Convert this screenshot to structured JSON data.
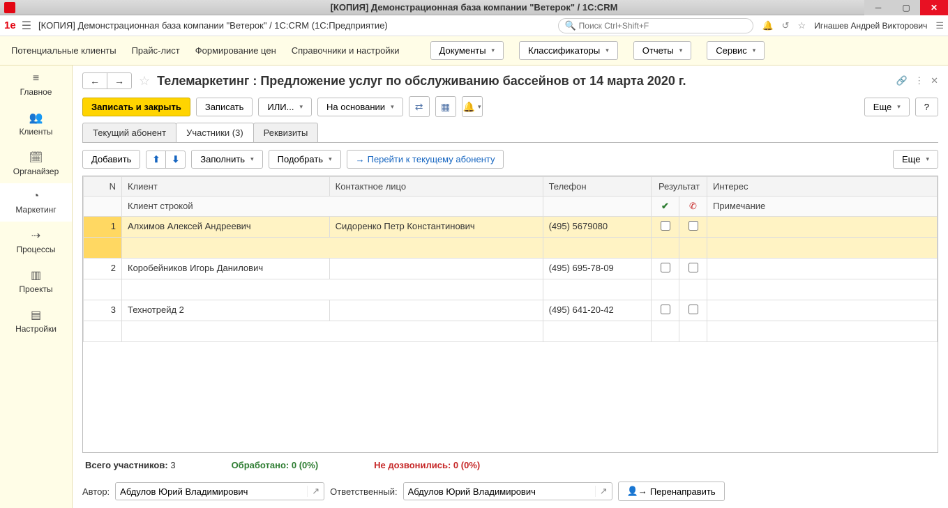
{
  "window": {
    "title": "[КОПИЯ] Демонстрационная база компании \"Ветерок\" / 1C:CRM"
  },
  "app": {
    "breadcrumb": "[КОПИЯ] Демонстрационная база компании \"Ветерок\" / 1C:CRM  (1С:Предприятие)",
    "search_placeholder": "Поиск Ctrl+Shift+F",
    "user": "Игнашев Андрей Викторович"
  },
  "menu": {
    "items": [
      "Потенциальные клиенты",
      "Прайс-лист",
      "Формирование цен",
      "Справочники и настройки"
    ],
    "buttons": [
      "Документы",
      "Классификаторы",
      "Отчеты",
      "Сервис"
    ]
  },
  "sidebar": [
    {
      "label": "Главное",
      "icon": "≡"
    },
    {
      "label": "Клиенты",
      "icon": "👥"
    },
    {
      "label": "Органайзер",
      "icon": "🗓"
    },
    {
      "label": "Маркетинг",
      "icon": "◔",
      "active": true
    },
    {
      "label": "Процессы",
      "icon": "⇢"
    },
    {
      "label": "Проекты",
      "icon": "▥"
    },
    {
      "label": "Настройки",
      "icon": "▤"
    }
  ],
  "page": {
    "title": "Телемаркетинг : Предложение услуг по обслуживанию бассейнов от 14 марта 2020 г.",
    "toolbar": {
      "save_close": "Записать и закрыть",
      "save": "Записать",
      "or": "ИЛИ...",
      "based_on": "На основании",
      "more": "Еще",
      "help": "?"
    },
    "tabs": [
      "Текущий абонент",
      "Участники (3)",
      "Реквизиты"
    ],
    "subtoolbar": {
      "add": "Добавить",
      "fill": "Заполнить",
      "pick": "Подобрать",
      "goto": "Перейти к текущему абоненту",
      "more": "Еще"
    },
    "columns": {
      "n": "N",
      "client": "Клиент",
      "contact": "Контактное лицо",
      "phone": "Телефон",
      "result": "Результат",
      "interest": "Интерес",
      "client_str": "Клиент строкой",
      "note": "Примечание"
    },
    "rows": [
      {
        "n": 1,
        "client": "Алхимов Алексей Андреевич",
        "contact": "Сидоренко Петр Константинович",
        "phone": "(495) 5679080",
        "selected": true
      },
      {
        "n": 2,
        "client": "Коробейников Игорь Данилович",
        "contact": "",
        "phone": "(495) 695-78-09"
      },
      {
        "n": 3,
        "client": "Технотрейд 2",
        "contact": "",
        "phone": "(495) 641-20-42"
      }
    ],
    "stats": {
      "total_label": "Всего участников:",
      "total": "3",
      "processed_label": "Обработано:",
      "processed": "0 (0%)",
      "noreach_label": "Не дозвонились:",
      "noreach": "0 (0%)"
    },
    "footer": {
      "author_label": "Автор:",
      "author": "Абдулов Юрий Владимирович",
      "resp_label": "Ответственный:",
      "resp": "Абдулов Юрий Владимирович",
      "redirect": "Перенаправить"
    }
  }
}
